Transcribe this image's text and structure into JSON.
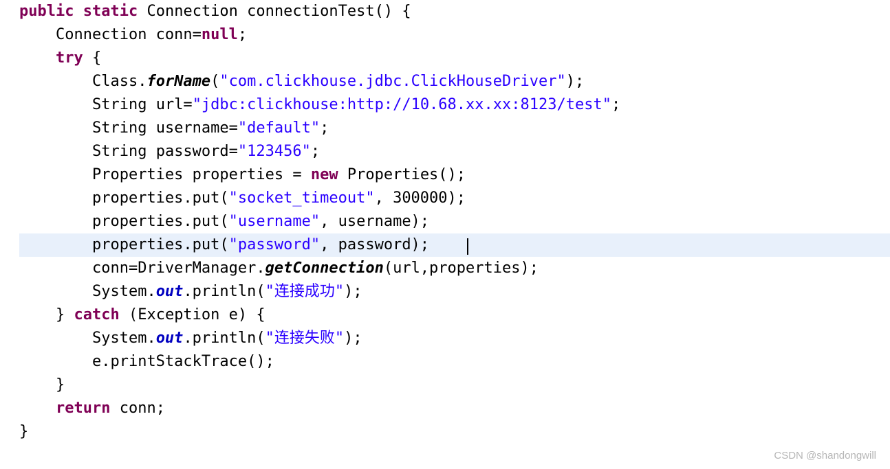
{
  "signature": {
    "public": "public",
    "static": "static",
    "return_type": "Connection",
    "name": "connectionTest",
    "open": "() {"
  },
  "line2": {
    "type": "Connection",
    "decl": " conn=",
    "null": "null",
    "end": ";"
  },
  "try_kw": "try",
  "try_open": " {",
  "forname": {
    "pre": "Class.",
    "fn": "forName",
    "open": "(",
    "arg": "\"com.clickhouse.jdbc.ClickHouseDriver\"",
    "close": ");"
  },
  "url_line": {
    "type": "String",
    "decl": " url=",
    "val": "\"jdbc:clickhouse:http://10.68.xx.xx:8123/test\"",
    "end": ";"
  },
  "user_line": {
    "type": "String",
    "decl": " username=",
    "val": "\"default\"",
    "end": ";"
  },
  "pass_line": {
    "type": "String",
    "decl": " password=",
    "val": "\"123456\"",
    "end": ";"
  },
  "props_line": {
    "pre": "Properties properties = ",
    "new": "new",
    "post": " Properties();"
  },
  "put1": {
    "pre": "properties.put(",
    "arg": "\"socket_timeout\"",
    "post": ", 300000);"
  },
  "put2": {
    "pre": "properties.put(",
    "arg": "\"username\"",
    "post": ", username);"
  },
  "put3": {
    "pre": "properties.put(",
    "arg": "\"password\"",
    "post": ", password);    "
  },
  "conn_line": {
    "pre": "conn=DriverManager.",
    "fn": "getConnection",
    "post": "(url,properties);"
  },
  "sysout1": {
    "pre": "System.",
    "out": "out",
    "mid": ".println(",
    "arg": "\"连接成功\"",
    "post": ");"
  },
  "catch": {
    "close_try": "} ",
    "catch_kw": "catch",
    "open": " (Exception e) {"
  },
  "sysout2": {
    "pre": "System.",
    "out": "out",
    "mid": ".println(",
    "arg": "\"连接失败\"",
    "post": ");"
  },
  "trace": "e.printStackTrace();",
  "close1": "}",
  "return_line": {
    "return": "return",
    "post": " conn;"
  },
  "close2": "}",
  "watermark": "CSDN @shandongwill"
}
